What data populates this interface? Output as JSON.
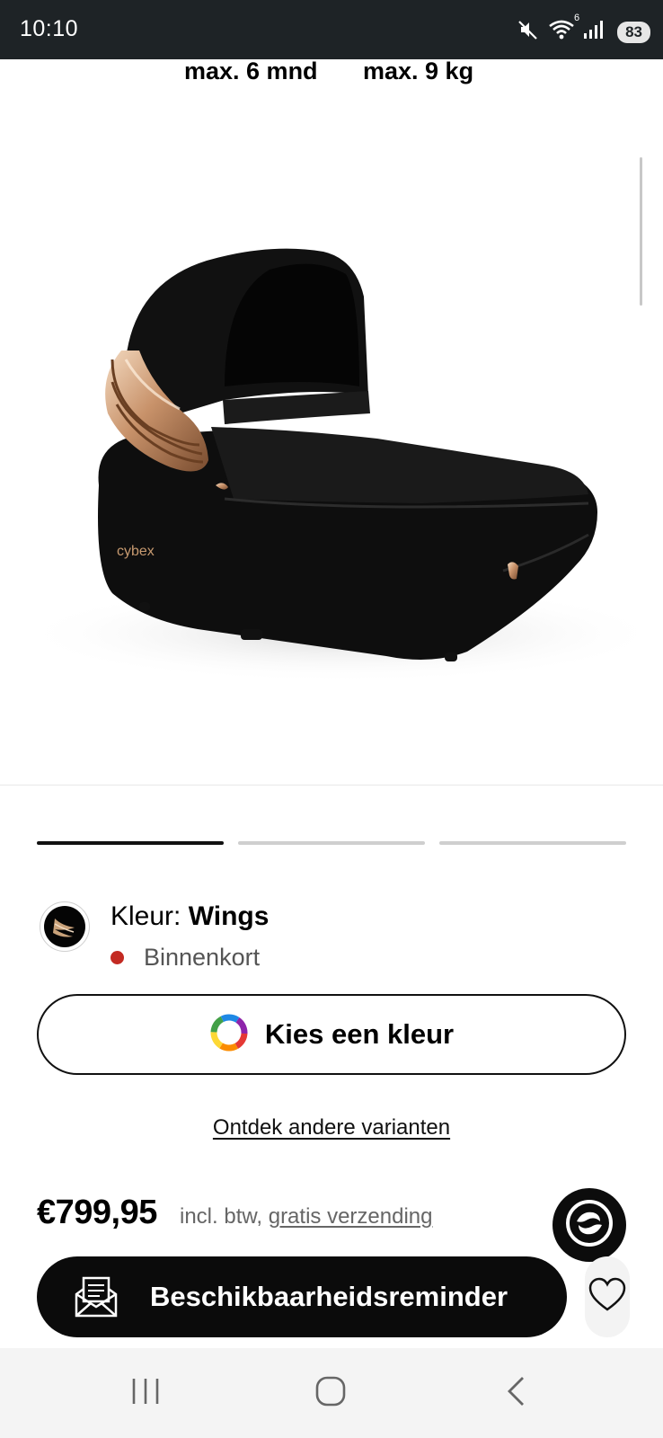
{
  "status_bar": {
    "time": "10:10",
    "wifi_badge": "6",
    "battery": "83",
    "icons": [
      "mute-icon",
      "wifi-icon",
      "signal-icon",
      "battery-icon"
    ]
  },
  "specs": {
    "age": "max. 6 mnd",
    "weight": "max. 9 kg"
  },
  "product": {
    "image_name": "cybex-carrycot-wings",
    "carousel": {
      "total": 3,
      "active_index": 0
    }
  },
  "color": {
    "label_prefix": "Kleur: ",
    "name": "Wings",
    "availability": "Binnenkort",
    "availability_color": "#c32a22"
  },
  "choose_color_button": {
    "label": "Kies een kleur",
    "icon": "color-wheel-icon"
  },
  "variants_link": "Ontdek andere varianten",
  "price": {
    "amount": "€799,95",
    "note_prefix": "incl. btw, ",
    "shipping_link": "gratis verzending"
  },
  "reminder_button": {
    "label": "Beschikbaarheidsreminder",
    "icon": "mail-icon"
  },
  "wishlist": {
    "icon": "heart-icon"
  },
  "brand_badge": {
    "icon": "cybex-logo-icon"
  },
  "nav_bar": {
    "items": [
      "recent-apps-icon",
      "home-icon",
      "back-icon"
    ]
  },
  "colors": {
    "dark": "#0b0b0b",
    "status_bar": "#1e2326",
    "accent_red": "#c32a22"
  }
}
